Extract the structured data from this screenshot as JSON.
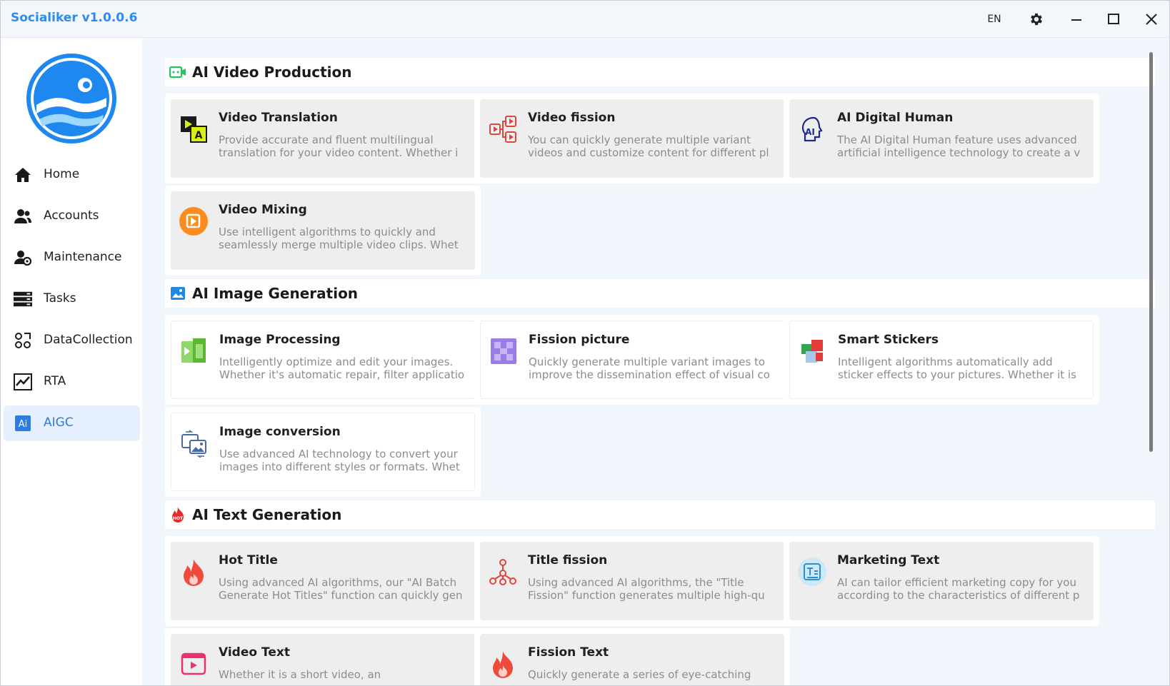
{
  "app": {
    "title": "Socialiker v1.0.0.6",
    "language": "EN"
  },
  "sidebar": {
    "items": [
      {
        "label": "Home",
        "icon": "home-icon"
      },
      {
        "label": "Accounts",
        "icon": "users-icon"
      },
      {
        "label": "Maintenance",
        "icon": "user-settings-icon"
      },
      {
        "label": "Tasks",
        "icon": "tasks-icon"
      },
      {
        "label": "DataCollection",
        "icon": "data-collection-icon"
      },
      {
        "label": "RTA",
        "icon": "chart-line-icon"
      },
      {
        "label": "AIGC",
        "icon": "ai-icon",
        "active": true
      }
    ]
  },
  "sections": [
    {
      "title": "AI Video Production",
      "icon": "video-camera-icon",
      "cards": [
        {
          "title": "Video Translation",
          "desc": "Provide accurate and fluent multilingual translation for your video content. Whether i",
          "icon": "video-translation-icon"
        },
        {
          "title": "Video fission",
          "desc": "You can quickly generate multiple variant videos and customize content for different pl",
          "icon": "video-fission-icon"
        },
        {
          "title": "AI Digital Human",
          "desc": "The AI Digital Human feature uses advanced artificial intelligence technology to create a v",
          "icon": "digital-human-icon"
        },
        {
          "title": "Video Mixing",
          "desc": "Use intelligent algorithms to quickly and seamlessly merge multiple video clips. Whet",
          "icon": "video-mixing-icon"
        }
      ]
    },
    {
      "title": "AI Image Generation",
      "icon": "image-icon",
      "cards": [
        {
          "title": "Image Processing",
          "desc": "Intelligently optimize and edit your images. Whether it's automatic repair, filter applicatio",
          "icon": "image-processing-icon"
        },
        {
          "title": "Fission picture",
          "desc": "Quickly generate multiple variant images to improve the dissemination effect of visual co",
          "icon": "fission-picture-icon"
        },
        {
          "title": "Smart Stickers",
          "desc": "Intelligent algorithms automatically add sticker effects to your pictures. Whether it is",
          "icon": "smart-stickers-icon"
        },
        {
          "title": "Image conversion",
          "desc": "Use advanced AI technology to convert your images into different styles or formats. Whet",
          "icon": "image-conversion-icon"
        }
      ]
    },
    {
      "title": "AI Text Generation",
      "icon": "hot-fire-icon",
      "cards": [
        {
          "title": "Hot Title",
          "desc": "Using advanced AI algorithms, our \"AI Batch Generate Hot Titles\" function can quickly gen",
          "icon": "hot-title-icon"
        },
        {
          "title": "Title fission",
          "desc": "Using advanced AI algorithms, the \"Title Fission\" function generates multiple high-qu",
          "icon": "title-fission-icon"
        },
        {
          "title": "Marketing Text",
          "desc": "AI can tailor efficient marketing copy for you according to the characteristics of different p",
          "icon": "marketing-text-icon"
        },
        {
          "title": "Video Text",
          "desc": "Whether it is a short video, an",
          "icon": "video-text-icon"
        },
        {
          "title": "Fission Text",
          "desc": "Quickly generate a series of eye-catching",
          "icon": "fission-text-icon"
        }
      ]
    }
  ]
}
